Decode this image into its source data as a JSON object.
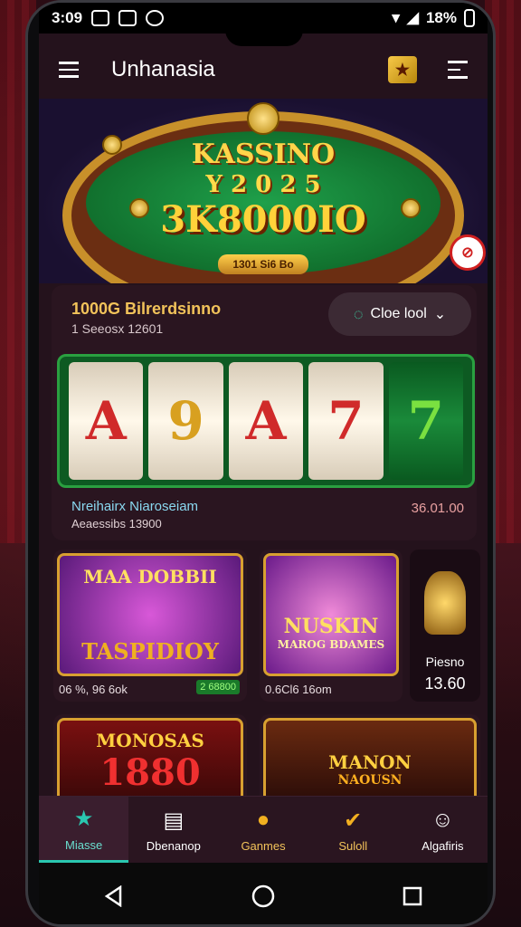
{
  "status_bar": {
    "time": "3:09",
    "battery": "18%"
  },
  "app_bar": {
    "title": "Unhanasia"
  },
  "hero": {
    "title": "KASSINO",
    "subtitle": "Y 2 0 2 5",
    "amount": "3K8000IO",
    "button_label": "1301 Si6 Bo"
  },
  "jackpot": {
    "title": "1000G Bilrerdsinno",
    "subtitle": "1 Seeosx 12601",
    "filter_button": "Cloe lool",
    "reels": [
      "A",
      "9",
      "A",
      "7",
      "7"
    ],
    "footer_label": "Nreihairx Niaroseiam",
    "footer_sub": "Aeaessibs 13900",
    "footer_value": "36.01.00"
  },
  "games": [
    {
      "art_title": "MAA DOBBII",
      "art_sub": "TASPIDIOY",
      "meta": "06 %, 96 6ok",
      "badge": "2 68800"
    },
    {
      "art_title": "NUSKIN",
      "art_sub": "MAROG BDAMES",
      "meta": "0.6Cl6 16om",
      "badge": ""
    },
    {
      "art_title": "",
      "art_sub": "",
      "meta": "Piesno",
      "value": "13.60"
    },
    {
      "art_title": "MONOSAS",
      "art_sub": "1880",
      "meta": "",
      "badge": ""
    },
    {
      "art_title": "MANON",
      "art_sub": "NAOUSN",
      "meta": "",
      "badge": ""
    }
  ],
  "bottom_nav": [
    {
      "label": "Miasse",
      "icon": "star-icon"
    },
    {
      "label": "Dbenanop",
      "icon": "document-icon"
    },
    {
      "label": "Ganmes",
      "icon": "chat-bubble-icon"
    },
    {
      "label": "Suloll",
      "icon": "check-badge-icon"
    },
    {
      "label": "Algafiris",
      "icon": "person-icon"
    }
  ],
  "colors": {
    "accent": "#2ac8b0",
    "gold": "#f2c35a",
    "surface": "#2a1520"
  }
}
